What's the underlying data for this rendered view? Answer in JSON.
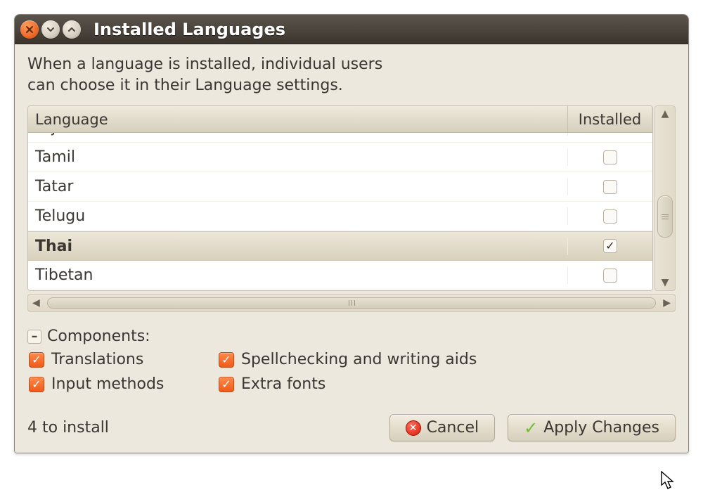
{
  "window": {
    "title": "Installed Languages"
  },
  "intro": {
    "line1": "When a language is installed, individual users",
    "line2": "can choose it in their Language settings."
  },
  "table": {
    "columns": {
      "language": "Language",
      "installed": "Installed"
    },
    "rows": [
      {
        "name": "Tajik",
        "installed": false,
        "selected": false,
        "partial": true
      },
      {
        "name": "Tamil",
        "installed": false,
        "selected": false,
        "partial": false
      },
      {
        "name": "Tatar",
        "installed": false,
        "selected": false,
        "partial": false
      },
      {
        "name": "Telugu",
        "installed": false,
        "selected": false,
        "partial": false
      },
      {
        "name": "Thai",
        "installed": true,
        "selected": true,
        "partial": false
      },
      {
        "name": "Tibetan",
        "installed": false,
        "selected": false,
        "partial": false
      }
    ]
  },
  "components": {
    "label": "Components:",
    "expander": "–",
    "items": [
      {
        "key": "translations",
        "label": "Translations",
        "checked": true
      },
      {
        "key": "spellchecking",
        "label": "Spellchecking and writing aids",
        "checked": true
      },
      {
        "key": "input_methods",
        "label": "Input methods",
        "checked": true
      },
      {
        "key": "extra_fonts",
        "label": "Extra fonts",
        "checked": true
      }
    ]
  },
  "footer": {
    "status": "4 to install",
    "cancel": "Cancel",
    "apply": "Apply Changes"
  }
}
